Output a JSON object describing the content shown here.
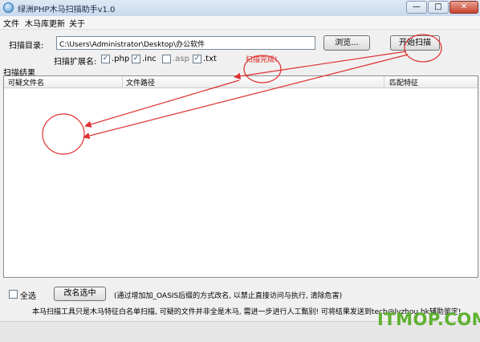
{
  "window": {
    "title": "绿洲PHP木马扫描助手v1.0",
    "controls": {
      "minimize": "—",
      "maximize": "□",
      "close": "✕"
    }
  },
  "menu": [
    "文件",
    "木马库更新",
    "关于"
  ],
  "form": {
    "dir_label": "扫描目录:",
    "dir_value": "C:\\Users\\Administrator\\Desktop\\办公软件",
    "browse_label": "浏览...",
    "scan_label": "开始扫描",
    "ext_label": "扫描扩展名:",
    "extensions": [
      {
        "label": ".php",
        "checked": true
      },
      {
        "label": ".inc",
        "checked": true
      },
      {
        "label": ".asp",
        "checked": false
      },
      {
        "label": ".txt",
        "checked": true
      }
    ],
    "status": "扫描完成!"
  },
  "results": {
    "label": "扫描结果",
    "columns": [
      "可疑文件名",
      "文件路径",
      "匹配特征"
    ],
    "rows": []
  },
  "bottom": {
    "select_all_label": "全选",
    "select_all_checked": false,
    "rename_label": "改名选中",
    "rename_note": "(通过增加加_OASIS后缀的方式改名, 以禁止直接访问与执行, 清除危害)",
    "footer": "本马扫描工具只是木马特征白名单扫描, 可疑的文件并非全是木马, 需进一步进行人工甄别! 可将结果发送到tech@lvzhou.hk辅助鉴定!"
  },
  "watermark": "ITMOP.COM",
  "colors": {
    "status": "#e02020",
    "annotation": "#e03030",
    "watermark": "#5fb130"
  }
}
